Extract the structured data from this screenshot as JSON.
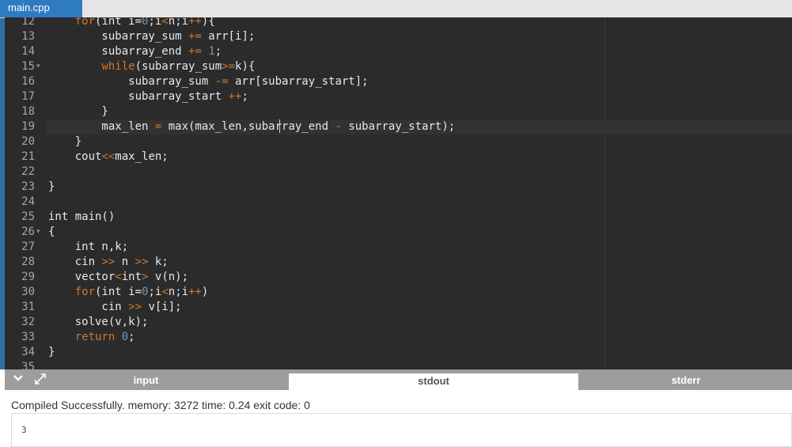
{
  "tab": {
    "filename": "main.cpp"
  },
  "editor": {
    "lines": [
      {
        "n": "12",
        "fold": false,
        "tokens": [
          [
            "    ",
            ""
          ],
          [
            "for",
            "kw"
          ],
          [
            "(int i=",
            ""
          ],
          [
            "0",
            "num"
          ],
          [
            ";i",
            ""
          ],
          [
            "<",
            "op"
          ],
          [
            "n;i",
            ""
          ],
          [
            "++",
            "op"
          ],
          [
            "){",
            ""
          ]
        ]
      },
      {
        "n": "13",
        "fold": false,
        "tokens": [
          [
            "        subarray_sum ",
            ""
          ],
          [
            "+=",
            "op"
          ],
          [
            " arr[i];",
            ""
          ]
        ]
      },
      {
        "n": "14",
        "fold": false,
        "tokens": [
          [
            "        subarray_end ",
            ""
          ],
          [
            "+=",
            "op"
          ],
          [
            " ",
            ""
          ],
          [
            "1",
            "num"
          ],
          [
            ";",
            ""
          ]
        ]
      },
      {
        "n": "15",
        "fold": true,
        "tokens": [
          [
            "        ",
            ""
          ],
          [
            "while",
            "kw"
          ],
          [
            "(subarray_sum",
            ""
          ],
          [
            ">=",
            "op"
          ],
          [
            "k){",
            ""
          ]
        ]
      },
      {
        "n": "16",
        "fold": false,
        "tokens": [
          [
            "            subarray_sum ",
            ""
          ],
          [
            "-=",
            "op"
          ],
          [
            " arr[subarray_start];",
            ""
          ]
        ]
      },
      {
        "n": "17",
        "fold": false,
        "tokens": [
          [
            "            subarray_start ",
            ""
          ],
          [
            "++",
            "op"
          ],
          [
            ";",
            ""
          ]
        ]
      },
      {
        "n": "18",
        "fold": false,
        "tokens": [
          [
            "        }",
            ""
          ]
        ]
      },
      {
        "n": "19",
        "fold": false,
        "tokens": [
          [
            "        max_len ",
            ""
          ],
          [
            "=",
            "op"
          ],
          [
            " max(max_len,subarray_end ",
            ""
          ],
          [
            "-",
            "op"
          ],
          [
            " subarray_start);",
            ""
          ]
        ]
      },
      {
        "n": "20",
        "fold": false,
        "tokens": [
          [
            "    }",
            ""
          ]
        ]
      },
      {
        "n": "21",
        "fold": false,
        "tokens": [
          [
            "    cout",
            ""
          ],
          [
            "<<",
            "op"
          ],
          [
            "max_len;",
            ""
          ]
        ]
      },
      {
        "n": "22",
        "fold": false,
        "tokens": [
          [
            "    ",
            ""
          ]
        ]
      },
      {
        "n": "23",
        "fold": false,
        "tokens": [
          [
            "}",
            ""
          ]
        ]
      },
      {
        "n": "24",
        "fold": false,
        "tokens": []
      },
      {
        "n": "25",
        "fold": false,
        "tokens": [
          [
            "int main()",
            ""
          ]
        ]
      },
      {
        "n": "26",
        "fold": true,
        "tokens": [
          [
            "{",
            ""
          ]
        ]
      },
      {
        "n": "27",
        "fold": false,
        "tokens": [
          [
            "    int n,k;",
            ""
          ]
        ]
      },
      {
        "n": "28",
        "fold": false,
        "tokens": [
          [
            "    cin ",
            ""
          ],
          [
            ">>",
            "op"
          ],
          [
            " n ",
            ""
          ],
          [
            ">>",
            "op"
          ],
          [
            " k;",
            ""
          ]
        ]
      },
      {
        "n": "29",
        "fold": false,
        "tokens": [
          [
            "    vector",
            ""
          ],
          [
            "<",
            "op"
          ],
          [
            "int",
            ""
          ],
          [
            ">",
            "op"
          ],
          [
            " v(n);",
            ""
          ]
        ]
      },
      {
        "n": "30",
        "fold": false,
        "tokens": [
          [
            "    ",
            ""
          ],
          [
            "for",
            "kw"
          ],
          [
            "(int i=",
            ""
          ],
          [
            "0",
            "num"
          ],
          [
            ";i",
            ""
          ],
          [
            "<",
            "op"
          ],
          [
            "n;i",
            ""
          ],
          [
            "++",
            "op"
          ],
          [
            ")",
            ""
          ]
        ]
      },
      {
        "n": "31",
        "fold": false,
        "tokens": [
          [
            "        cin ",
            ""
          ],
          [
            ">>",
            "op"
          ],
          [
            " v[i];",
            ""
          ]
        ]
      },
      {
        "n": "32",
        "fold": false,
        "tokens": [
          [
            "    solve(v,k);",
            ""
          ]
        ]
      },
      {
        "n": "33",
        "fold": false,
        "tokens": [
          [
            "    ",
            ""
          ],
          [
            "return",
            "kw"
          ],
          [
            " ",
            ""
          ],
          [
            "0",
            "num"
          ],
          [
            ";",
            ""
          ]
        ]
      },
      {
        "n": "34",
        "fold": false,
        "tokens": [
          [
            "}",
            ""
          ]
        ]
      },
      {
        "n": "35",
        "fold": false,
        "tokens": []
      }
    ],
    "active_line": "19"
  },
  "panel": {
    "tabs": [
      "input",
      "stdout",
      "stderr"
    ],
    "active_tab": "stdout",
    "collapse_icon": "chevron-down-icon",
    "expand_icon": "expand-arrows-icon"
  },
  "status": "Compiled Successfully. memory: 3272 time: 0.24 exit code: 0",
  "output": "3"
}
